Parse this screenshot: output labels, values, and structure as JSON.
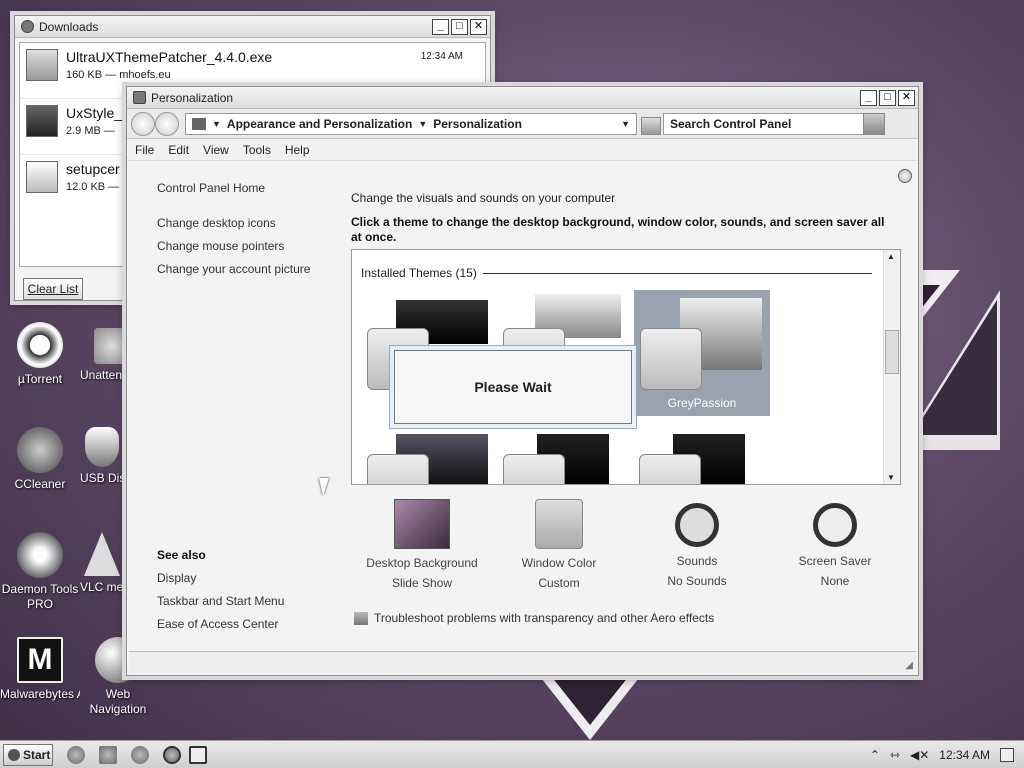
{
  "desktop": {
    "icons": [
      {
        "label": "µTorrent"
      },
      {
        "label": "Unattended Software"
      },
      {
        "label": "CCleaner"
      },
      {
        "label": "USB Disk Security"
      },
      {
        "label": "Daemon Tools PRO"
      },
      {
        "label": "VLC media player"
      },
      {
        "label": "Malwarebytes Anti-Malware"
      },
      {
        "label": "Web Navigation"
      }
    ]
  },
  "downloads": {
    "title": "Downloads",
    "items": [
      {
        "name": "UltraUXThemePatcher_4.4.0.exe",
        "meta": "160 KB — mhoefs.eu",
        "time": "12:34 AM"
      },
      {
        "name": "UxStyle_",
        "meta": "2.9 MB —",
        "time": ""
      },
      {
        "name": "setupcer",
        "meta": "12.0 KB —",
        "time": ""
      }
    ],
    "clear_label": "Clear List"
  },
  "personalization": {
    "title": "Personalization",
    "breadcrumb": [
      "Appearance and Personalization",
      "Personalization"
    ],
    "search_placeholder": "Search Control Panel",
    "menu": [
      "File",
      "Edit",
      "View",
      "Tools",
      "Help"
    ],
    "left_links": [
      "Control Panel Home",
      "Change desktop icons",
      "Change mouse pointers",
      "Change your account picture"
    ],
    "see_also_title": "See also",
    "see_also": [
      "Display",
      "Taskbar and Start Menu",
      "Ease of Access Center"
    ],
    "heading": "Change the visuals and sounds on your computer",
    "subheading": "Click a theme to change the desktop background, window color, sounds, and screen saver all at once.",
    "group_label": "Installed Themes (15)",
    "selected_theme": "GreyPassion",
    "wait_text": "Please Wait",
    "bottom": [
      {
        "title": "Desktop Background",
        "value": "Slide Show"
      },
      {
        "title": "Window Color",
        "value": "Custom"
      },
      {
        "title": "Sounds",
        "value": "No Sounds"
      },
      {
        "title": "Screen Saver",
        "value": "None"
      }
    ],
    "troubleshoot": "Troubleshoot problems with transparency and other Aero effects"
  },
  "taskbar": {
    "start_label": "Start",
    "clock": "12:34 AM"
  }
}
